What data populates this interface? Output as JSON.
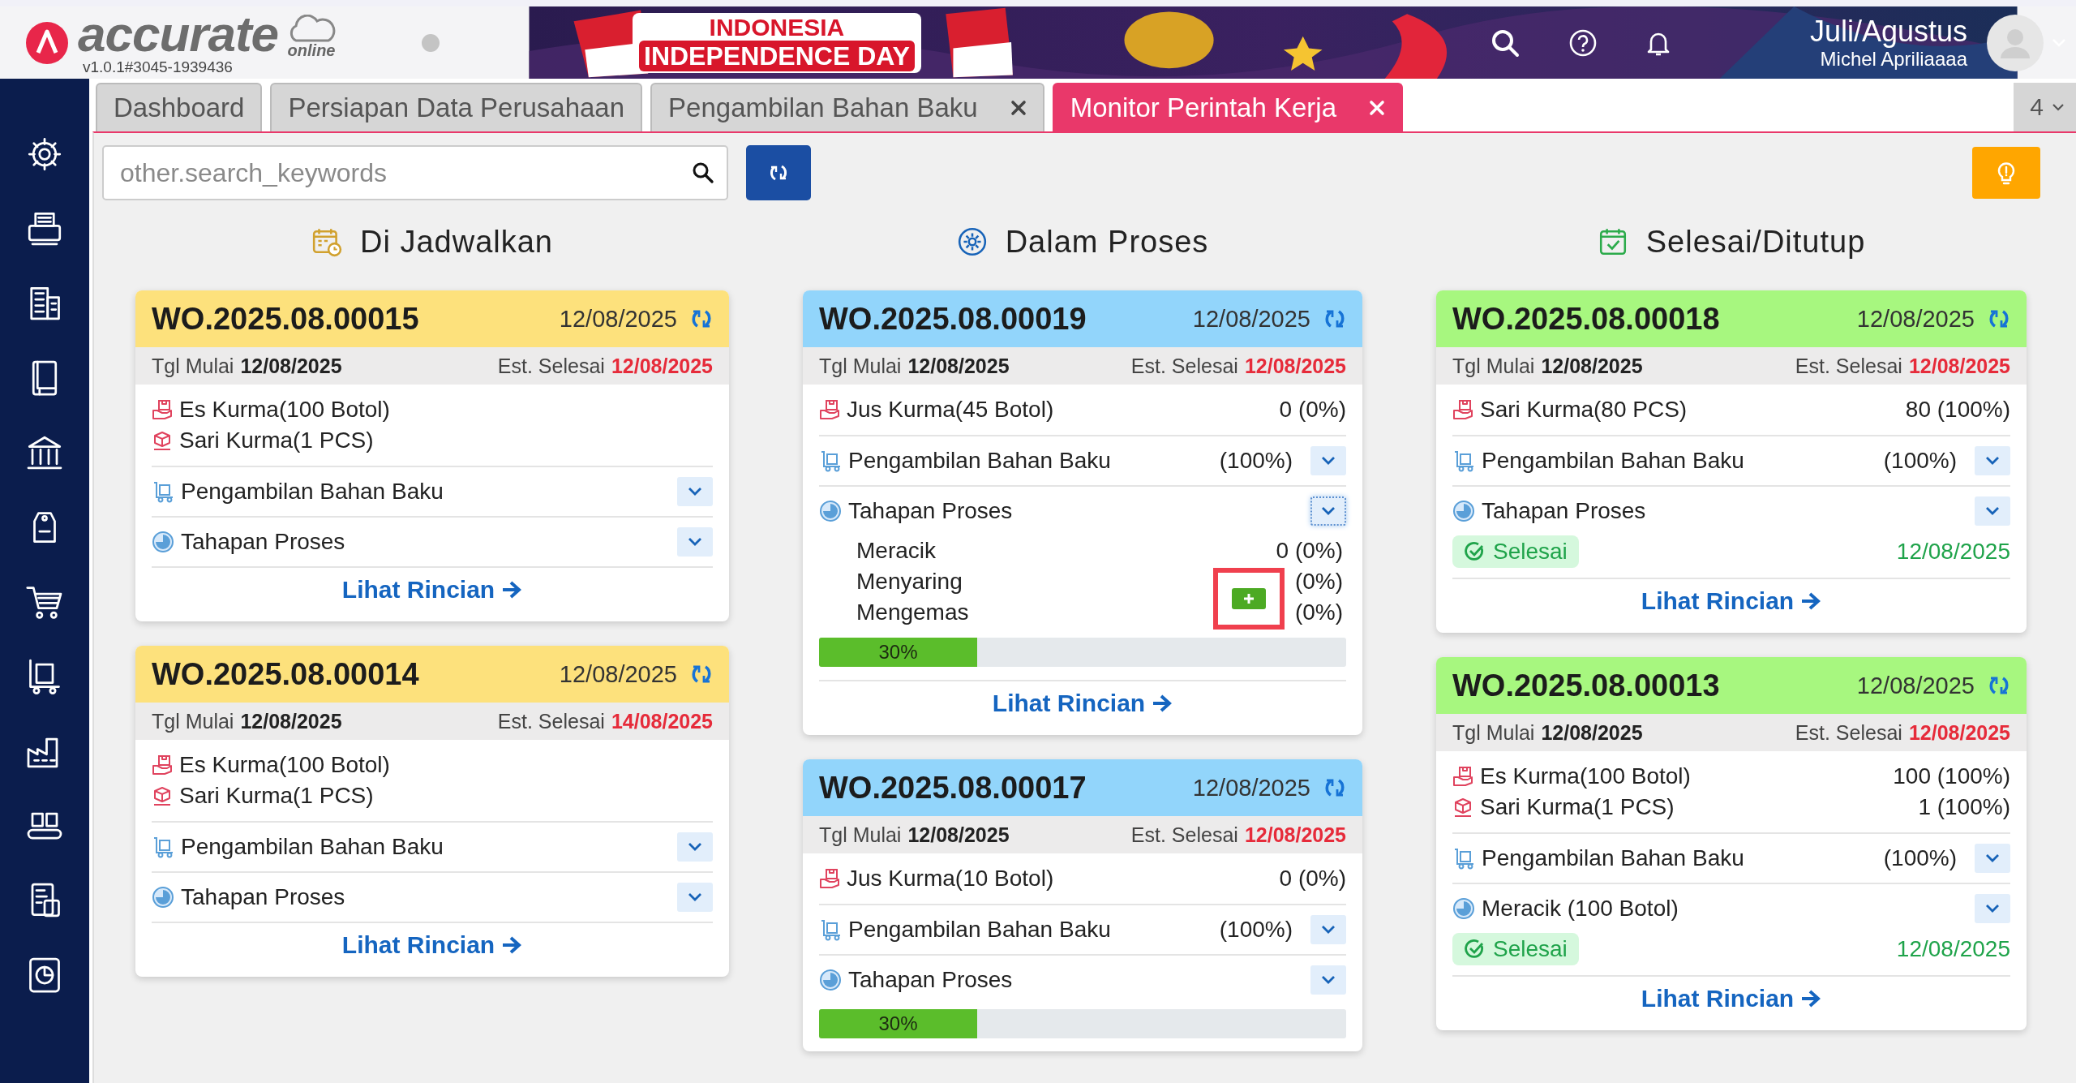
{
  "header": {
    "logo": "accurate",
    "logo_sub": "online",
    "version": "v1.0.1#3045-1939436",
    "banner": {
      "line_1": "INDONESIA",
      "line_2": "INDEPENDENCE DAY"
    },
    "period": "Juli/Agustus",
    "user": "Michel Apriliaaaa"
  },
  "tabs": [
    {
      "label": "Dashboard",
      "closable": false,
      "selected": false
    },
    {
      "label": "Persiapan Data Perusahaan",
      "closable": false,
      "selected": false
    },
    {
      "label": "Pengambilan Bahan Baku",
      "closable": true,
      "selected": false
    },
    {
      "label": "Monitor Perintah Kerja",
      "closable": true,
      "selected": true
    }
  ],
  "tab_count": "4",
  "search": {
    "placeholder": "other.search_keywords"
  },
  "columns": [
    {
      "kind": "scheduled",
      "title": "Di Jadwalkan",
      "color": "#fde17c",
      "cards": [
        {
          "number": "WO.2025.08.00015",
          "date": "12/08/2025",
          "start_label": "Tgl Mulai",
          "start": "12/08/2025",
          "end_label": "Est. Selesai",
          "end": "12/08/2025",
          "products": [
            {
              "kind": "bundle",
              "name": "Es Kurma(100 Botol)"
            },
            {
              "kind": "box",
              "name": "Sari Kurma(1 PCS)"
            }
          ],
          "sections": [
            {
              "kind": "material",
              "label": "Pengambilan Bahan Baku",
              "expanded": false
            },
            {
              "kind": "process",
              "label": "Tahapan Proses",
              "expanded": false
            }
          ],
          "link": "Lihat Rincian"
        },
        {
          "number": "WO.2025.08.00014",
          "date": "12/08/2025",
          "start_label": "Tgl Mulai",
          "start": "12/08/2025",
          "end_label": "Est. Selesai",
          "end": "14/08/2025",
          "products": [
            {
              "kind": "bundle",
              "name": "Es Kurma(100 Botol)"
            },
            {
              "kind": "box",
              "name": "Sari Kurma(1 PCS)"
            }
          ],
          "sections": [
            {
              "kind": "material",
              "label": "Pengambilan Bahan Baku",
              "expanded": false
            },
            {
              "kind": "process",
              "label": "Tahapan Proses",
              "expanded": false
            }
          ],
          "link": "Lihat Rincian"
        }
      ]
    },
    {
      "kind": "in_progress",
      "title": "Dalam Proses",
      "color": "#92d5fb",
      "cards": [
        {
          "number": "WO.2025.08.00019",
          "date": "12/08/2025",
          "start_label": "Tgl Mulai",
          "start": "12/08/2025",
          "end_label": "Est. Selesai",
          "end": "12/08/2025",
          "products": [
            {
              "kind": "bundle",
              "name": "Jus Kurma(45 Botol)",
              "value": "0 (0%)"
            }
          ],
          "sections": [
            {
              "kind": "material",
              "label": "Pengambilan Bahan Baku",
              "value": "(100%)",
              "expanded": false
            },
            {
              "kind": "process",
              "label": "Tahapan Proses",
              "expanded": true,
              "stages": [
                {
                  "name": "Meracik",
                  "value": "0 (0%)",
                  "add_button": false
                },
                {
                  "name": "Menyaring",
                  "value": "(0%)",
                  "add_button": false
                },
                {
                  "name": "Mengemas",
                  "value": "(0%)",
                  "add_button": true
                }
              ],
              "level": 0.3,
              "level_label": "30%"
            }
          ],
          "link": "Lihat Rincian"
        },
        {
          "number": "WO.2025.08.00017",
          "date": "12/08/2025",
          "start_label": "Tgl Mulai",
          "start": "12/08/2025",
          "end_label": "Est. Selesai",
          "end": "12/08/2025",
          "products": [
            {
              "kind": "bundle",
              "name": "Jus Kurma(10 Botol)",
              "value": "0 (0%)"
            }
          ],
          "sections": [
            {
              "kind": "material",
              "label": "Pengambilan Bahan Baku",
              "value": "(100%)",
              "expanded": false
            },
            {
              "kind": "process",
              "label": "Tahapan Proses",
              "expanded": false,
              "level": 0.3,
              "level_label": "30%"
            }
          ]
        }
      ]
    },
    {
      "kind": "done",
      "title": "Selesai/Ditutup",
      "color": "#a7f77f",
      "cards": [
        {
          "number": "WO.2025.08.00018",
          "date": "12/08/2025",
          "start_label": "Tgl Mulai",
          "start": "12/08/2025",
          "end_label": "Est. Selesai",
          "end": "12/08/2025",
          "products": [
            {
              "kind": "bundle",
              "name": "Sari Kurma(80 PCS)",
              "value": "80 (100%)"
            }
          ],
          "sections": [
            {
              "kind": "material",
              "label": "Pengambilan Bahan Baku",
              "value": "(100%)",
              "expanded": false
            },
            {
              "kind": "process",
              "label": "Tahapan Proses",
              "expanded": false,
              "status": "Selesai",
              "status_date": "12/08/2025"
            }
          ],
          "link": "Lihat Rincian"
        },
        {
          "number": "WO.2025.08.00013",
          "date": "12/08/2025",
          "start_label": "Tgl Mulai",
          "start": "12/08/2025",
          "end_label": "Est. Selesai",
          "end": "12/08/2025",
          "products": [
            {
              "kind": "bundle",
              "name": "Es Kurma(100 Botol)",
              "value": "100 (100%)"
            },
            {
              "kind": "box",
              "name": "Sari Kurma(1 PCS)",
              "value": "1 (100%)"
            }
          ],
          "sections": [
            {
              "kind": "material",
              "label": "Pengambilan Bahan Baku",
              "value": "(100%)",
              "expanded": false
            },
            {
              "kind": "process",
              "label": "Meracik (100 Botol)",
              "expanded": false,
              "status": "Selesai",
              "status_date": "12/08/2025"
            }
          ],
          "link": "Lihat Rincian"
        }
      ]
    }
  ]
}
